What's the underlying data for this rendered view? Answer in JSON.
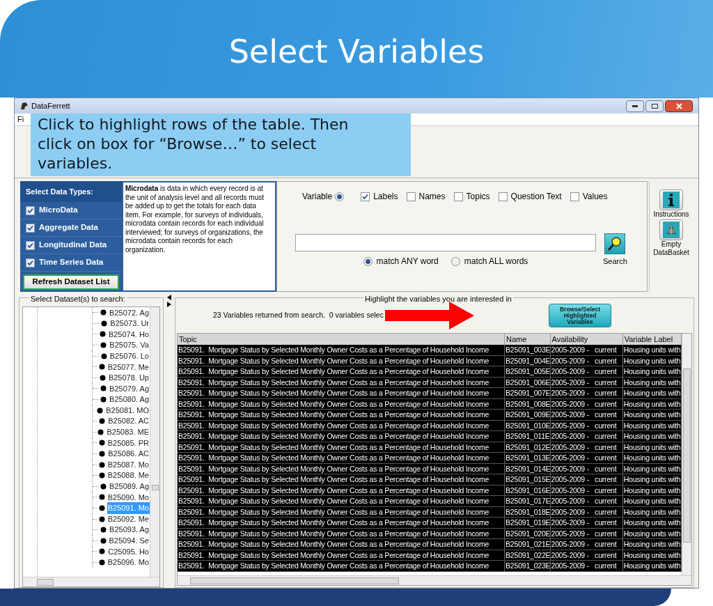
{
  "slide": {
    "title": "Select Variables"
  },
  "window": {
    "title": "DataFerrett",
    "menu": [
      "Fi"
    ]
  },
  "callout": {
    "text": "Click to highlight rows of the table. Then click on box for “Browse…” to select variables."
  },
  "data_types": {
    "heading": "Select Data Types:",
    "items": [
      {
        "label": "MicroData",
        "checked": true
      },
      {
        "label": "Aggregate Data",
        "checked": true
      },
      {
        "label": "Longitudinal Data",
        "checked": true
      },
      {
        "label": "Time Series Data",
        "checked": true
      }
    ],
    "refresh_button": "Refresh Dataset List"
  },
  "description": "**Microdata** is data in which every record is at the unit of analysis level and all records must be added up to get the totals for each data item. For example, for surveys of individuals, microdata contain records for each individual interviewed; for surveys of organizations, the microdata contain records for each organization.",
  "search": {
    "variable": {
      "label": "Variable",
      "selected": true
    },
    "fields": [
      {
        "label": "Labels",
        "checked": true
      },
      {
        "label": "Names",
        "checked": false
      },
      {
        "label": "Topics",
        "checked": false
      },
      {
        "label": "Question Text",
        "checked": false
      },
      {
        "label": "Values",
        "checked": false
      }
    ],
    "match_options": [
      {
        "label": "match ANY word",
        "selected": true
      },
      {
        "label": "match ALL words",
        "selected": false
      }
    ],
    "search_button": "Search"
  },
  "tools": [
    {
      "kind": "info",
      "label": "Instructions"
    },
    {
      "kind": "basket",
      "label": "Empty DataBasket"
    }
  ],
  "datasets": {
    "legend": "Select Dataset(s) to search:",
    "items": [
      {
        "label": "B25072. Ag",
        "selected": false
      },
      {
        "label": "B25073. Ur",
        "selected": false
      },
      {
        "label": "B25074. Ho",
        "selected": false
      },
      {
        "label": "B25075. Va",
        "selected": false
      },
      {
        "label": "B25076. Lo",
        "selected": false
      },
      {
        "label": "B25077. Me",
        "selected": false
      },
      {
        "label": "B25078. Up",
        "selected": false
      },
      {
        "label": "B25079. Ag",
        "selected": false
      },
      {
        "label": "B25080. Ag",
        "selected": false
      },
      {
        "label": "B25081. MO",
        "selected": false
      },
      {
        "label": "B25082. AC",
        "selected": false
      },
      {
        "label": "B25083. ME",
        "selected": false
      },
      {
        "label": "B25085. PR",
        "selected": false
      },
      {
        "label": "B25086. AC",
        "selected": false
      },
      {
        "label": "B25087. Mo",
        "selected": false
      },
      {
        "label": "B25088. Me",
        "selected": false
      },
      {
        "label": "B25089. Ag",
        "selected": false
      },
      {
        "label": "B25090. Mo",
        "selected": false
      },
      {
        "label": "B25091. Mo",
        "selected": true
      },
      {
        "label": "B25092. Me",
        "selected": false
      },
      {
        "label": "B25093. Ag",
        "selected": false
      },
      {
        "label": "B25094. Se",
        "selected": false
      },
      {
        "label": "C25095. Ho",
        "selected": false
      },
      {
        "label": "B25096. Mo",
        "selected": false
      }
    ]
  },
  "results": {
    "legend": "Highlight the variables you are interested in",
    "status": "23 Variables returned from search.  0 variables selec",
    "browse_button": "Browse/Select Highlighted Variables",
    "columns": [
      "Topic",
      "Name",
      "Availability",
      "Variable Label"
    ],
    "rows": [
      {
        "selected": true,
        "cells": [
          "B25091.  Mortgage Status by Selected Monthly Owner Costs as a Percentage of Household Income",
          "B25091_003E",
          "2005-2009 -   current",
          "Housing units with"
        ]
      },
      {
        "selected": true,
        "cells": [
          "B25091.  Mortgage Status by Selected Monthly Owner Costs as a Percentage of Household Income",
          "B25091_004E",
          "2005-2009 -   current",
          "Housing units with"
        ]
      },
      {
        "selected": true,
        "cells": [
          "B25091.  Mortgage Status by Selected Monthly Owner Costs as a Percentage of Household Income",
          "B25091_005E",
          "2005-2009 -   current",
          "Housing units with"
        ]
      },
      {
        "selected": true,
        "cells": [
          "B25091.  Mortgage Status by Selected Monthly Owner Costs as a Percentage of Household Income",
          "B25091_006E",
          "2005-2009 -   current",
          "Housing units with"
        ]
      },
      {
        "selected": true,
        "cells": [
          "B25091.  Mortgage Status by Selected Monthly Owner Costs as a Percentage of Household Income",
          "B25091_007E",
          "2005-2009 -   current",
          "Housing units with"
        ]
      },
      {
        "selected": true,
        "cells": [
          "B25091.  Mortgage Status by Selected Monthly Owner Costs as a Percentage of Household Income",
          "B25091_008E",
          "2005-2009 -   current",
          "Housing units with"
        ]
      },
      {
        "selected": true,
        "cells": [
          "B25091.  Mortgage Status by Selected Monthly Owner Costs as a Percentage of Household Income",
          "B25091_009E",
          "2005-2009 -   current",
          "Housing units with"
        ]
      },
      {
        "selected": true,
        "cells": [
          "B25091.  Mortgage Status by Selected Monthly Owner Costs as a Percentage of Household Income",
          "B25091_010E",
          "2005-2009 -   current",
          "Housing units with"
        ]
      },
      {
        "selected": true,
        "cells": [
          "B25091.  Mortgage Status by Selected Monthly Owner Costs as a Percentage of Household Income",
          "B25091_011E",
          "2005-2009 -   current",
          "Housing units with"
        ]
      },
      {
        "selected": true,
        "cells": [
          "B25091.  Mortgage Status by Selected Monthly Owner Costs as a Percentage of Household Income",
          "B25091_012E",
          "2005-2009 -   current",
          "Housing units with"
        ]
      },
      {
        "selected": true,
        "cells": [
          "B25091.  Mortgage Status by Selected Monthly Owner Costs as a Percentage of Household Income",
          "B25091_013E",
          "2005-2009 -   current",
          "Housing units with"
        ]
      },
      {
        "selected": true,
        "cells": [
          "B25091.  Mortgage Status by Selected Monthly Owner Costs as a Percentage of Household Income",
          "B25091_014E",
          "2005-2009 -   current",
          "Housing units with"
        ]
      },
      {
        "selected": true,
        "cells": [
          "B25091.  Mortgage Status by Selected Monthly Owner Costs as a Percentage of Household Income",
          "B25091_015E",
          "2005-2009 -   current",
          "Housing units with"
        ]
      },
      {
        "selected": true,
        "cells": [
          "B25091.  Mortgage Status by Selected Monthly Owner Costs as a Percentage of Household Income",
          "B25091_016E",
          "2005-2009 -   current",
          "Housing units with"
        ]
      },
      {
        "selected": true,
        "cells": [
          "B25091.  Mortgage Status by Selected Monthly Owner Costs as a Percentage of Household Income",
          "B25091_017E",
          "2005-2009 -   current",
          "Housing units with"
        ]
      },
      {
        "selected": true,
        "cells": [
          "B25091.  Mortgage Status by Selected Monthly Owner Costs as a Percentage of Household Income",
          "B25091_018E",
          "2005-2009 -   current",
          "Housing units with"
        ]
      },
      {
        "selected": true,
        "cells": [
          "B25091.  Mortgage Status by Selected Monthly Owner Costs as a Percentage of Household Income",
          "B25091_019E",
          "2005-2009 -   current",
          "Housing units with"
        ]
      },
      {
        "selected": true,
        "cells": [
          "B25091.  Mortgage Status by Selected Monthly Owner Costs as a Percentage of Household Income",
          "B25091_020E",
          "2005-2009 -   current",
          "Housing units with"
        ]
      },
      {
        "selected": true,
        "cells": [
          "B25091.  Mortgage Status by Selected Monthly Owner Costs as a Percentage of Household Income",
          "B25091_021E",
          "2005-2009 -   current",
          "Housing units with"
        ]
      },
      {
        "selected": true,
        "cells": [
          "B25091.  Mortgage Status by Selected Monthly Owner Costs as a Percentage of Household Income",
          "B25091_022E",
          "2005-2009 -   current",
          "Housing units with"
        ]
      },
      {
        "selected": true,
        "cells": [
          "B25091.  Mortgage Status by Selected Monthly Owner Costs as a Percentage of Household Income",
          "B25091_023E",
          "2005-2009 -   current",
          "Housing units with"
        ]
      }
    ]
  }
}
